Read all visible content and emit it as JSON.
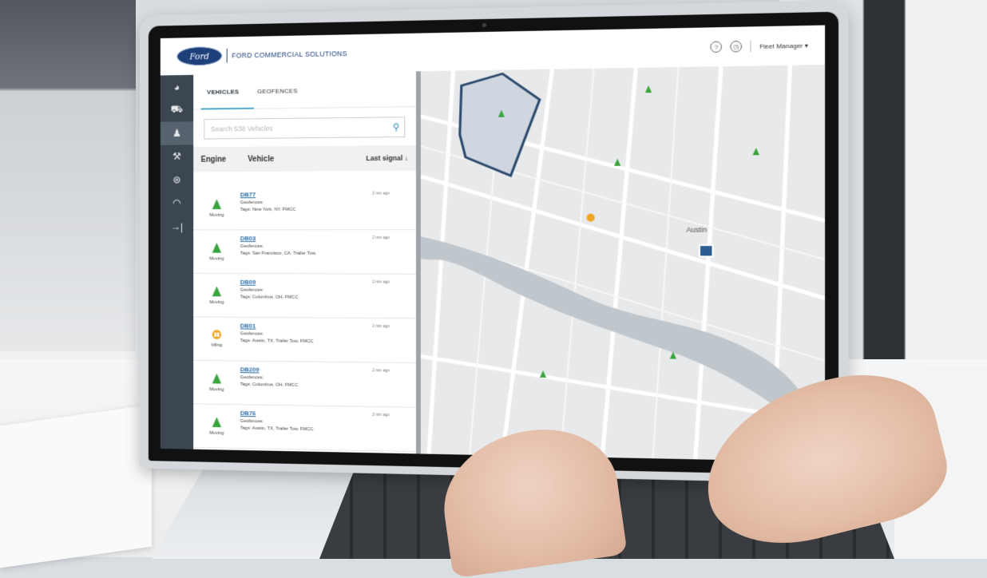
{
  "header": {
    "logo_text": "Ford",
    "brand_name": "FORD COMMERCIAL SOLUTIONS",
    "help_icon": "question-circle-icon",
    "history_icon": "clock-icon",
    "user_menu": "Fleet Manager ▾"
  },
  "sidenav": {
    "items": [
      {
        "icon": "pie-chart-icon",
        "glyph": "◕"
      },
      {
        "icon": "car-icon",
        "glyph": "⛟"
      },
      {
        "icon": "driver-icon",
        "glyph": "♟"
      },
      {
        "icon": "wrench-icon",
        "glyph": "⚒"
      },
      {
        "icon": "steering-wheel-icon",
        "glyph": "⊛"
      },
      {
        "icon": "gauge-icon",
        "glyph": "◠"
      },
      {
        "icon": "logout-icon",
        "glyph": "→|"
      }
    ]
  },
  "tabs": {
    "vehicles": "VEHICLES",
    "geofences": "GEOFENCES"
  },
  "search": {
    "placeholder": "Search 538 Vehicles"
  },
  "columns": {
    "engine": "Engine",
    "vehicle": "Vehicle",
    "last_signal": "Last signal ↓"
  },
  "vehicles": [
    {
      "id": "DB77",
      "status": "Moving",
      "geofences": "Geofences:",
      "tags": "Tags: New York, NY, FMCC",
      "time": "2 min ago"
    },
    {
      "id": "DB03",
      "status": "Moving",
      "geofences": "Geofences:",
      "tags": "Tags: San Francisco, CA, Trailer Tow,",
      "time": "2 min ago"
    },
    {
      "id": "DB09",
      "status": "Moving",
      "geofences": "Geofences:",
      "tags": "Tags: Columbus, OH, FMCC",
      "time": "2 min ago"
    },
    {
      "id": "DB01",
      "status": "Idling",
      "geofences": "Geofences:",
      "tags": "Tags: Austin, TX, Trailer Tow, FMCC",
      "time": "2 min ago"
    },
    {
      "id": "DB209",
      "status": "Moving",
      "geofences": "Geofences:",
      "tags": "Tags: Columbus, OH, FMCC",
      "time": "2 min ago"
    },
    {
      "id": "DB76",
      "status": "Moving",
      "geofences": "Geofences:",
      "tags": "Tags: Austin, TX, Trailer Tow, FMCC",
      "time": "2 min ago"
    }
  ],
  "map": {
    "city_label": "Austin"
  },
  "colors": {
    "moving": "#3aa53f",
    "idle": "#f0a526",
    "nav_bg": "#3b4650",
    "accent": "#4aa9c9"
  }
}
